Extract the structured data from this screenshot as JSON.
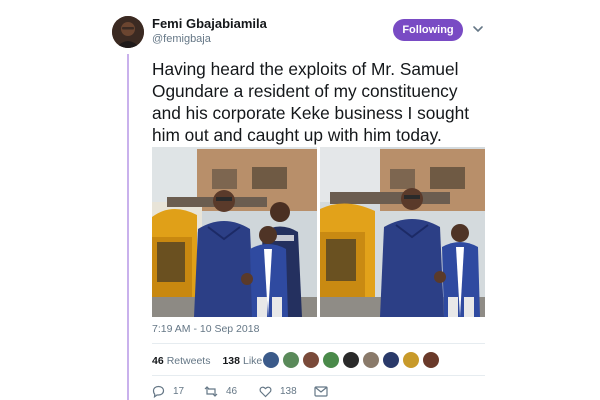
{
  "tweet": {
    "display_name": "Femi Gbajabiamila",
    "handle": "@femigbaja",
    "follow_label": "Following",
    "text": "Having heard the exploits of Mr. Samuel\nOgundare a resident of my constituency\nand his corporate Keke business I sought\nhim out and caught up with him today.",
    "timestamp": "7:19 AM - 10 Sep 2018",
    "stats": {
      "retweets": {
        "count": "46",
        "label": "Retweets"
      },
      "likes": {
        "count": "138",
        "label": "Likes"
      }
    },
    "actions": {
      "reply_count": "17",
      "retweet_count": "46",
      "like_count": "138"
    }
  },
  "icons": {
    "more": "chevron-down-icon",
    "reply": "reply-icon",
    "retweet": "retweet-icon",
    "like": "heart-icon",
    "dm": "envelope-icon"
  },
  "colors": {
    "accent": "#794bc4",
    "thread_line": "#c9b1ec",
    "muted_text": "#657786",
    "text": "#14171a"
  }
}
